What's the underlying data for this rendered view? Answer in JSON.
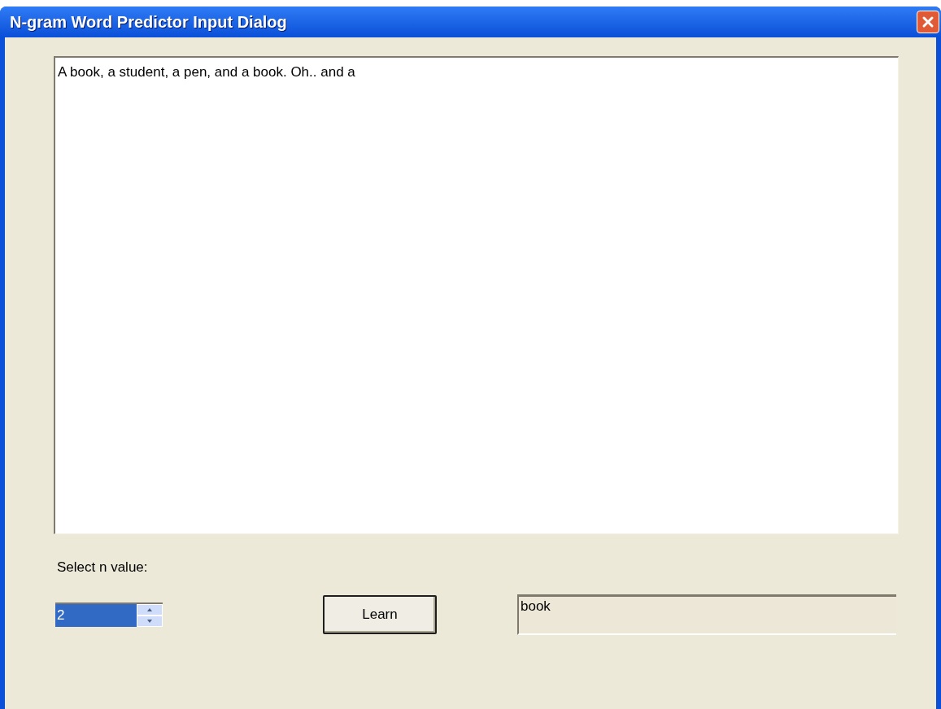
{
  "window": {
    "title": "N-gram Word Predictor Input Dialog"
  },
  "text_area": {
    "value": "A book, a student, a pen, and a book. Oh.. and a"
  },
  "n_label": "Select n value:",
  "n_spinner": {
    "value": "2",
    "highlighted": true
  },
  "learn_button": "Learn",
  "prediction_field": {
    "value": "book"
  }
}
